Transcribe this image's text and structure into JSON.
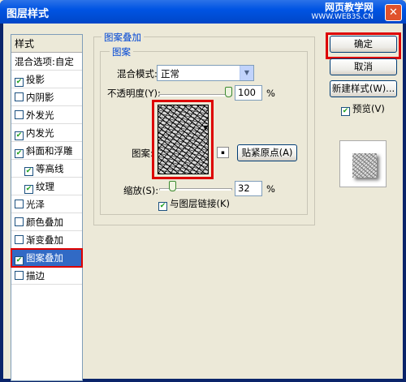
{
  "window": {
    "title": "图层样式",
    "watermark_line1": "网页教学网",
    "watermark_line2": "WWW.WEB3S.CN",
    "close": "✕"
  },
  "sidebar": {
    "header": "样式",
    "items": [
      {
        "label": "混合选项:自定",
        "checkbox": false,
        "checked": false
      },
      {
        "label": "投影",
        "checkbox": true,
        "checked": true
      },
      {
        "label": "内阴影",
        "checkbox": true,
        "checked": false
      },
      {
        "label": "外发光",
        "checkbox": true,
        "checked": false
      },
      {
        "label": "内发光",
        "checkbox": true,
        "checked": true
      },
      {
        "label": "斜面和浮雕",
        "checkbox": true,
        "checked": true
      },
      {
        "label": "等高线",
        "checkbox": true,
        "checked": true,
        "indent": true
      },
      {
        "label": "纹理",
        "checkbox": true,
        "checked": true,
        "indent": true
      },
      {
        "label": "光泽",
        "checkbox": true,
        "checked": false
      },
      {
        "label": "颜色叠加",
        "checkbox": true,
        "checked": false
      },
      {
        "label": "渐变叠加",
        "checkbox": true,
        "checked": false
      },
      {
        "label": "图案叠加",
        "checkbox": true,
        "checked": true,
        "selected": true
      },
      {
        "label": "描边",
        "checkbox": true,
        "checked": false
      }
    ]
  },
  "pattern_overlay": {
    "group_title": "图案叠加",
    "sub_title": "图案",
    "blend_mode_label": "混合模式:",
    "blend_mode_value": "正常",
    "opacity_label": "不透明度(Y):",
    "opacity_value": "100",
    "opacity_unit": "%",
    "opacity_level": 1.0,
    "pattern_label": "图案:",
    "snap_button": "贴紧原点(A)",
    "scale_label": "缩放(S):",
    "scale_value": "32",
    "scale_unit": "%",
    "scale_level": 0.03,
    "link_label": "与图层链接(K)",
    "link_checked": true
  },
  "actions": {
    "ok": "确定",
    "cancel": "取消",
    "new_style": "新建样式(W)...",
    "preview_label": "预览(V)",
    "preview_checked": true
  },
  "colors": {
    "title_blue": "#0054e3",
    "highlight_red": "#dd0000",
    "selection_blue": "#316ac5",
    "check_green": "#21a121"
  }
}
